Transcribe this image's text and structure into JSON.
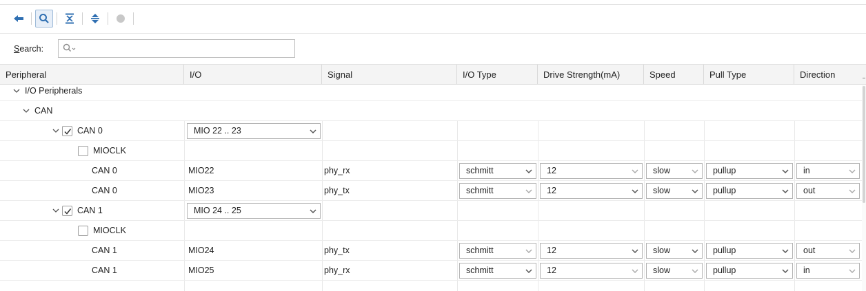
{
  "search": {
    "label_prefix": "S",
    "label_rest": "earch:",
    "placeholder": ""
  },
  "columns": [
    "Peripheral",
    "I/O",
    "Signal",
    "I/O Type",
    "Drive Strength(mA)",
    "Speed",
    "Pull Type",
    "Direction"
  ],
  "tree": {
    "io_peripherals": "I/O Peripherals",
    "can_group": "CAN"
  },
  "can0": {
    "label": "CAN 0",
    "mio_range": "MIO 22 .. 23",
    "mioclk": "MIOCLK",
    "rows": [
      {
        "peripheral": "CAN 0",
        "io": "MIO22",
        "signal": "phy_rx",
        "io_type": "schmitt",
        "drive": "12",
        "speed": "slow",
        "pull": "pullup",
        "direction": "in"
      },
      {
        "peripheral": "CAN 0",
        "io": "MIO23",
        "signal": "phy_tx",
        "io_type": "schmitt",
        "drive": "12",
        "speed": "slow",
        "pull": "pullup",
        "direction": "out"
      }
    ]
  },
  "can1": {
    "label": "CAN 1",
    "mio_range": "MIO 24 .. 25",
    "mioclk": "MIOCLK",
    "rows": [
      {
        "peripheral": "CAN 1",
        "io": "MIO24",
        "signal": "phy_tx",
        "io_type": "schmitt",
        "drive": "12",
        "speed": "slow",
        "pull": "pullup",
        "direction": "out"
      },
      {
        "peripheral": "CAN 1",
        "io": "MIO25",
        "signal": "phy_rx",
        "io_type": "schmitt",
        "drive": "12",
        "speed": "slow",
        "pull": "pullup",
        "direction": "in"
      }
    ]
  },
  "colors": {
    "icon_blue": "#2f6fb2",
    "icon_gray": "#c8c8c8",
    "arrow_dark": "#555555",
    "arrow_light": "#a8a8a8"
  }
}
